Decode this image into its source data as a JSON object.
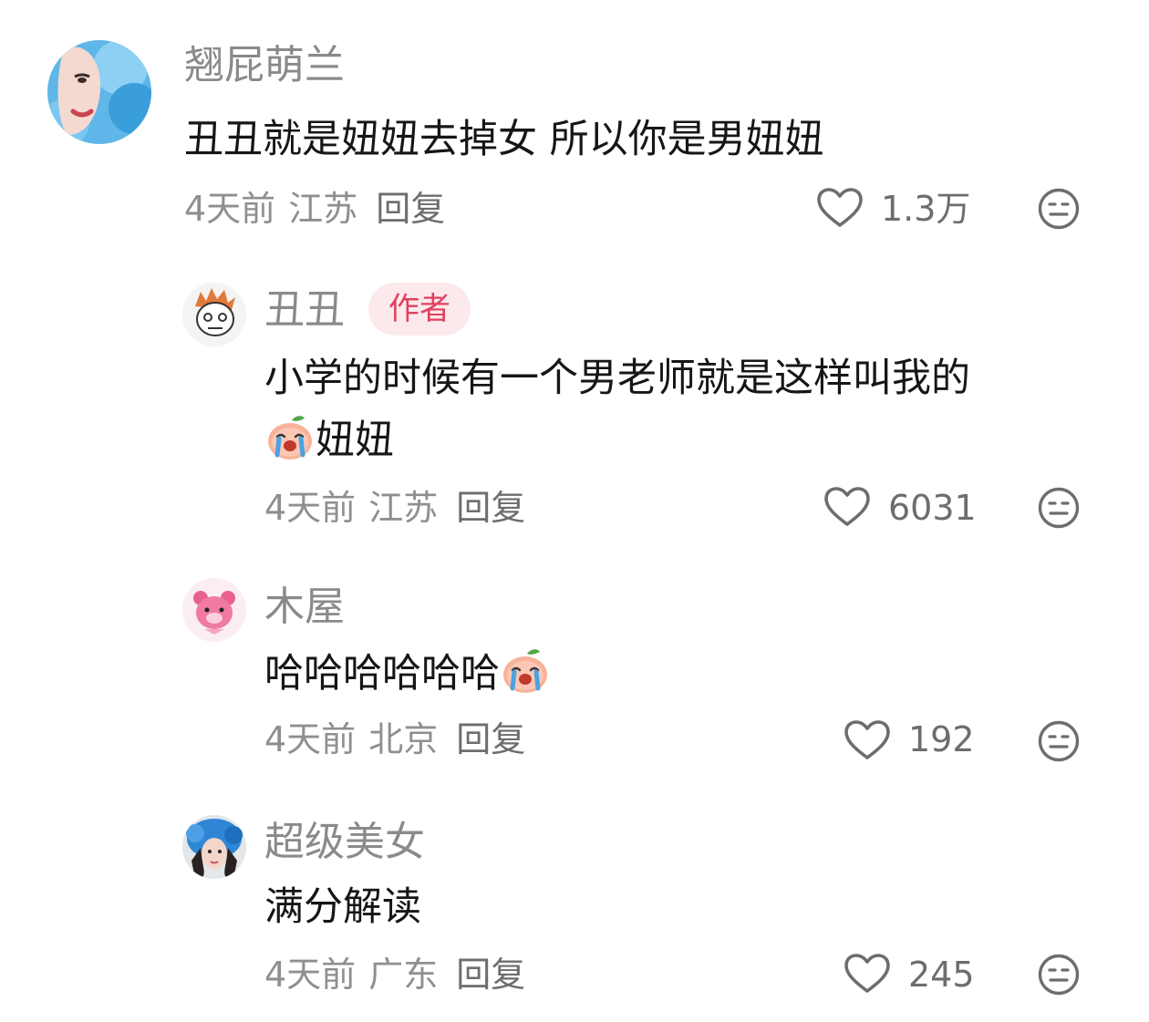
{
  "comments": [
    {
      "username": "翘屁萌兰",
      "author_badge": "",
      "content_line1": "丑丑就是妞妞去掉女 所以你是男妞妞",
      "content_line2": "",
      "time": "4天前",
      "location": "江苏",
      "reply_label": "回复",
      "like_count": "1.3万",
      "avatar_icon": "avatar-blue-fur-hood-icon"
    },
    {
      "username": "丑丑",
      "author_badge": "作者",
      "content_line1": "小学的时候有一个男老师就是这样叫我的",
      "content_line2": "妞妞",
      "time": "4天前",
      "location": "江苏",
      "reply_label": "回复",
      "like_count": "6031",
      "avatar_icon": "avatar-cartoon-boy-icon"
    },
    {
      "username": "木屋",
      "author_badge": "",
      "content_line1": "哈哈哈哈哈哈",
      "content_line2": "",
      "time": "4天前",
      "location": "北京",
      "reply_label": "回复",
      "like_count": "192",
      "avatar_icon": "avatar-pink-bear-icon"
    },
    {
      "username": "超级美女",
      "author_badge": "",
      "content_line1": "满分解读",
      "content_line2": "",
      "time": "4天前",
      "location": "广东",
      "reply_label": "回复",
      "like_count": "245",
      "avatar_icon": "avatar-blue-hood-girl-icon"
    }
  ],
  "icons": {
    "like": "heart-outline-icon",
    "dislike": "meh-face-icon",
    "emoji": "crying-peach-emoji-icon"
  },
  "colors": {
    "username": "#8a8a8a",
    "content": "#161616",
    "meta": "#8f8f8f",
    "badge_bg": "#fbe9ec",
    "badge_text": "#e0415e"
  }
}
